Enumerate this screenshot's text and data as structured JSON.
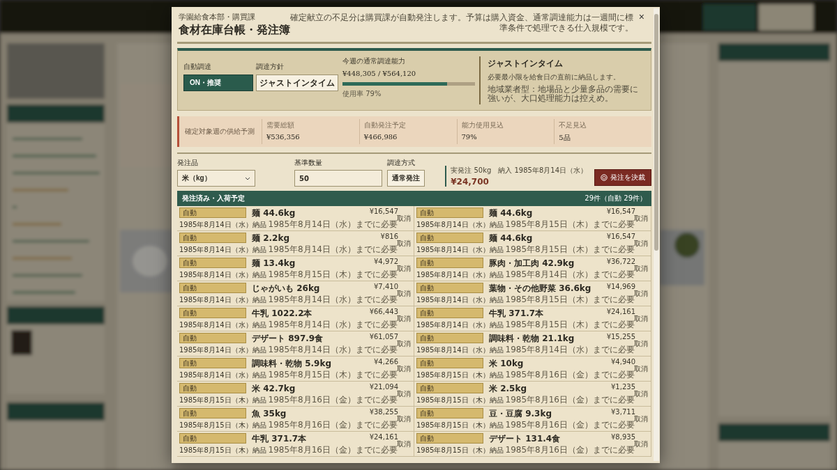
{
  "dialog": {
    "department": "学園給食本部・購買課",
    "title": "食材在庫台帳・発注簿",
    "description": "確定献立の不足分は購買課が自動発注します。予算は購入資金、通常調達能力は一週間に標準条件で処理できる仕入規模です。",
    "close": "×"
  },
  "procurement": {
    "auto": {
      "label": "自動調達",
      "value": "ON・推奨",
      "on": true
    },
    "policy": {
      "label": "調達方針",
      "value": "ジャストインタイム"
    },
    "capacity": {
      "label": "今週の通常調達能力",
      "amount": "¥448,305 / ¥564,120",
      "level": 0.79,
      "usage": "使用率 79%"
    },
    "policy_info": {
      "title": "ジャストインタイム",
      "text": "必要最小限を給食日の直前に納品します。",
      "note": "地域業者型：地場品と少量多品の需要に強いが、大口処理能力は控えめ。"
    }
  },
  "forecast": {
    "title": "確定対象週の供給予測",
    "stats": [
      {
        "label": "需要総額",
        "value": "¥536,356"
      },
      {
        "label": "自動発注予定",
        "value": "¥466,986"
      },
      {
        "label": "能力使用見込",
        "value": "79%"
      },
      {
        "label": "不足見込",
        "value": "5品"
      }
    ]
  },
  "order_form": {
    "item": {
      "label": "発注品",
      "value": "米（kg）"
    },
    "quantity": {
      "label": "基準数量",
      "value": "50"
    },
    "method": {
      "label": "調達方式",
      "value": "通常発注"
    },
    "summary": "実発注 50kg　納入 1985年8月14日（水）",
    "total": "¥24,700",
    "submit": "発注を決裁"
  },
  "orders": {
    "title": "発注済み・入荷予定",
    "count": "29件（自動 29件）",
    "items": [
      {
        "tag": "自動",
        "name": "麺 44.6kg",
        "price": "¥16,547",
        "delivery": "1985年8月14日（水）納品",
        "need": "1985年8月14日（水）までに必要",
        "action": "取消"
      },
      {
        "tag": "自動",
        "name": "麺 44.6kg",
        "price": "¥16,547",
        "delivery": "1985年8月14日（水）納品",
        "need": "1985年8月15日（木）までに必要",
        "action": "取消"
      },
      {
        "tag": "自動",
        "name": "麺 2.2kg",
        "price": "¥816",
        "delivery": "1985年8月14日（水）納品",
        "need": "1985年8月14日（水）までに必要",
        "action": "取消"
      },
      {
        "tag": "自動",
        "name": "麺 44.6kg",
        "price": "¥16,547",
        "delivery": "1985年8月14日（水）納品",
        "need": "1985年8月15日（木）までに必要",
        "action": "取消"
      },
      {
        "tag": "自動",
        "name": "麺 13.4kg",
        "price": "¥4,972",
        "delivery": "1985年8月14日（水）納品",
        "need": "1985年8月15日（木）までに必要",
        "action": "取消"
      },
      {
        "tag": "自動",
        "name": "豚肉・加工肉 42.9kg",
        "price": "¥36,722",
        "delivery": "1985年8月14日（水）納品",
        "need": "1985年8月14日（水）までに必要",
        "action": "取消"
      },
      {
        "tag": "自動",
        "name": "じゃがいも 26kg",
        "price": "¥7,410",
        "delivery": "1985年8月14日（水）納品",
        "need": "1985年8月14日（水）までに必要",
        "action": "取消"
      },
      {
        "tag": "自動",
        "name": "葉物・その他野菜 36.6kg",
        "price": "¥14,969",
        "delivery": "1985年8月14日（水）納品",
        "need": "1985年8月15日（木）までに必要",
        "action": "取消"
      },
      {
        "tag": "自動",
        "name": "牛乳 1022.2本",
        "price": "¥66,443",
        "delivery": "1985年8月14日（水）納品",
        "need": "1985年8月14日（水）までに必要",
        "action": "取消"
      },
      {
        "tag": "自動",
        "name": "牛乳 371.7本",
        "price": "¥24,161",
        "delivery": "1985年8月14日（水）納品",
        "need": "1985年8月15日（木）までに必要",
        "action": "取消"
      },
      {
        "tag": "自動",
        "name": "デザート 897.9食",
        "price": "¥61,057",
        "delivery": "1985年8月14日（水）納品",
        "need": "1985年8月14日（水）までに必要",
        "action": "取消"
      },
      {
        "tag": "自動",
        "name": "調味料・乾物 21.1kg",
        "price": "¥15,255",
        "delivery": "1985年8月14日（水）納品",
        "need": "1985年8月14日（水）までに必要",
        "action": "取消"
      },
      {
        "tag": "自動",
        "name": "調味料・乾物 5.9kg",
        "price": "¥4,266",
        "delivery": "1985年8月14日（水）納品",
        "need": "1985年8月15日（木）までに必要",
        "action": "取消"
      },
      {
        "tag": "自動",
        "name": "米 10kg",
        "price": "¥4,940",
        "delivery": "1985年8月15日（木）納品",
        "need": "1985年8月16日（金）までに必要",
        "action": "取消"
      },
      {
        "tag": "自動",
        "name": "米 42.7kg",
        "price": "¥21,094",
        "delivery": "1985年8月15日（木）納品",
        "need": "1985年8月16日（金）までに必要",
        "action": "取消"
      },
      {
        "tag": "自動",
        "name": "米 2.5kg",
        "price": "¥1,235",
        "delivery": "1985年8月15日（木）納品",
        "need": "1985年8月16日（金）までに必要",
        "action": "取消"
      },
      {
        "tag": "自動",
        "name": "魚 35kg",
        "price": "¥38,255",
        "delivery": "1985年8月15日（木）納品",
        "need": "1985年8月16日（金）までに必要",
        "action": "取消"
      },
      {
        "tag": "自動",
        "name": "豆・豆腐 9.3kg",
        "price": "¥3,711",
        "delivery": "1985年8月15日（木）納品",
        "need": "1985年8月16日（金）までに必要",
        "action": "取消"
      },
      {
        "tag": "自動",
        "name": "牛乳 371.7本",
        "price": "¥24,161",
        "delivery": "1985年8月15日（木）納品",
        "need": "1985年8月16日（金）までに必要",
        "action": "取消"
      },
      {
        "tag": "自動",
        "name": "デザート 131.4食",
        "price": "¥8,935",
        "delivery": "1985年8月15日（木）納品",
        "need": "1985年8月16日（金）までに必要",
        "action": "取消"
      }
    ]
  }
}
